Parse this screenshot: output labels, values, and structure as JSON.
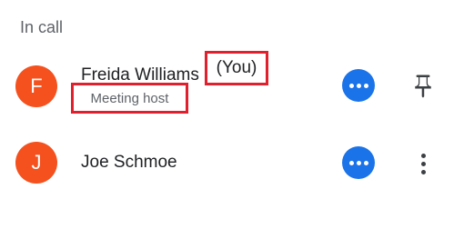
{
  "section": {
    "title": "In call"
  },
  "participants": [
    {
      "initial": "F",
      "name": "Freida Williams",
      "you_label": "(You)",
      "role": "Meeting host",
      "avatar_color": "#f4511e",
      "more_icon": "more-horizontal-icon",
      "action_icon": "pin-icon"
    },
    {
      "initial": "J",
      "name": "Joe Schmoe",
      "avatar_color": "#f4511e",
      "more_icon": "more-horizontal-icon",
      "action_icon": "more-vertical-icon"
    }
  ],
  "colors": {
    "accent": "#1a73e8",
    "highlight": "#e0202c",
    "secondary_text": "#5f6368"
  }
}
